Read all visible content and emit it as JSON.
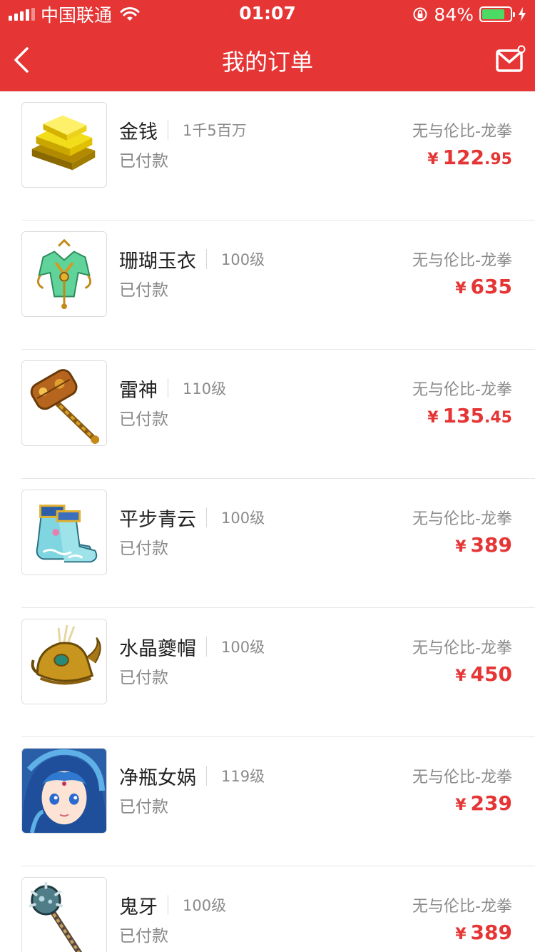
{
  "status_bar": {
    "carrier": "中国联通",
    "time": "01:07",
    "battery_percent": "84%",
    "battery_level": 0.84
  },
  "nav": {
    "title": "我的订单",
    "back_icon": "chevron-left-icon",
    "mail_icon": "mail-icon"
  },
  "colors": {
    "primary": "#e53535",
    "battery_fill": "#4cd964"
  },
  "orders": [
    {
      "name": "金钱",
      "spec": "1千5百万",
      "status": "已付款",
      "server": "无与伦比-龙拳",
      "currency": "¥",
      "price_int": "122",
      "price_dec": ".95",
      "image": "gold-ingot"
    },
    {
      "name": "珊瑚玉衣",
      "spec": "100级",
      "status": "已付款",
      "server": "无与伦比-龙拳",
      "currency": "¥",
      "price_int": "635",
      "price_dec": "",
      "image": "coral-armor"
    },
    {
      "name": "雷神",
      "spec": "110级",
      "status": "已付款",
      "server": "无与伦比-龙拳",
      "currency": "¥",
      "price_int": "135",
      "price_dec": ".45",
      "image": "thunder-hammer"
    },
    {
      "name": "平步青云",
      "spec": "100级",
      "status": "已付款",
      "server": "无与伦比-龙拳",
      "currency": "¥",
      "price_int": "389",
      "price_dec": "",
      "image": "cloud-boots"
    },
    {
      "name": "水晶夔帽",
      "spec": "100级",
      "status": "已付款",
      "server": "无与伦比-龙拳",
      "currency": "¥",
      "price_int": "450",
      "price_dec": "",
      "image": "crystal-helmet"
    },
    {
      "name": "净瓶女娲",
      "spec": "119级",
      "status": "已付款",
      "server": "无与伦比-龙拳",
      "currency": "¥",
      "price_int": "239",
      "price_dec": "",
      "image": "nuwa-portrait"
    },
    {
      "name": "鬼牙",
      "spec": "100级",
      "status": "已付款",
      "server": "无与伦比-龙拳",
      "currency": "¥",
      "price_int": "389",
      "price_dec": "",
      "image": "ghost-fang-mace"
    }
  ]
}
